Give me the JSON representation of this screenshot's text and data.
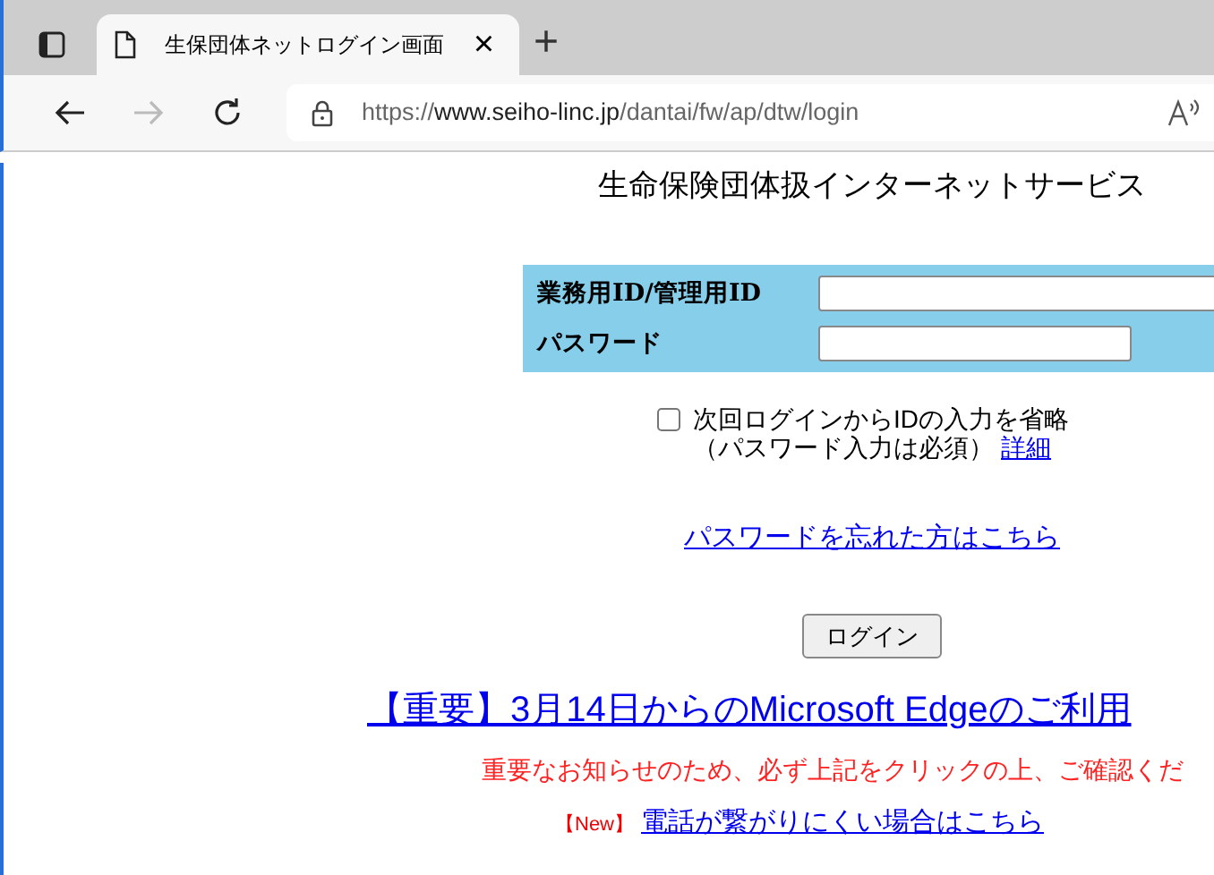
{
  "browser": {
    "tab": {
      "title": "生保団体ネットログイン画面",
      "selected": true,
      "close": "×"
    },
    "new_tab": "+",
    "address": {
      "scheme": "https://",
      "host": "www.seiho-linc.jp",
      "path": "/dantai/fw/ap/dtw/login"
    }
  },
  "page": {
    "title": "生命保険団体扱インターネットサービス",
    "fields": [
      {
        "label": "業務用ID/管理用ID",
        "kind": "text"
      },
      {
        "label": "パスワード",
        "kind": "password"
      }
    ],
    "remember": {
      "checked": false,
      "label": "次回ログインからIDの入力を省略",
      "note": "（パスワード入力は必須）",
      "link": "詳細"
    },
    "forgot_link": "パスワードを忘れた方はこちら",
    "login_button": "ログイン",
    "notice_link": "【重要】3月14日からのMicrosoft Edgeのご利用",
    "notice_text": "重要なお知らせのため、必ず上記をクリックの上、ご確認くだ",
    "new_tag": "【New】",
    "phone_link": "電話が繋がりにくい場合はこちら"
  }
}
